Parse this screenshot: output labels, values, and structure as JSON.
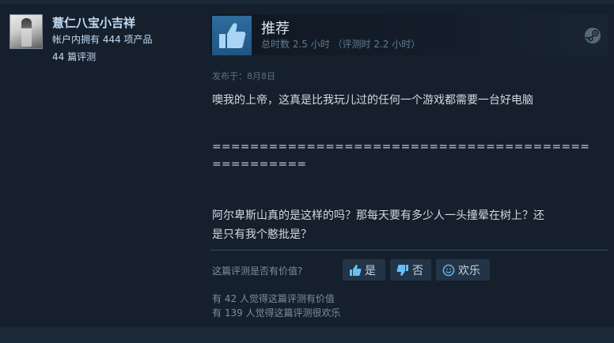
{
  "author": {
    "name": "薏仁八宝小吉祥",
    "products": "帐户内拥有 444 项产品",
    "reviews": "44 篇评测"
  },
  "review": {
    "verdict": "推荐",
    "hours": "总时数 2.5 小时 （评测时 2.2 小时）",
    "posted": "发布于：8月8日",
    "body": {
      "line1": "噢我的上帝，这真是比我玩儿过的任何一个游戏都需要一台好电脑",
      "line2": "========================================",
      "line3": "==========",
      "line4": "阿尔卑斯山真的是这样的吗？那每天要有多少人一头撞晕在树上？还",
      "line5": "是只有我个憨批是？"
    }
  },
  "vote": {
    "question": "这篇评测是否有价值?",
    "yes": "是",
    "no": "否",
    "funny": "欢乐"
  },
  "stats": {
    "helpful": "有 42 人觉得这篇评测有价值",
    "funny": "有 139 人觉得这篇评测很欢乐"
  },
  "icons": {
    "thumb": "thumbs-up-icon",
    "platform": "steam-icon",
    "yes": "thumbs-up-icon",
    "no": "thumbs-down-icon",
    "funny": "smiley-icon"
  },
  "colors": {
    "background": "#16202d",
    "accent": "#2e6d9c",
    "name": "#c1dbf4",
    "text": "#d0dae3",
    "muted": "#7d8d9c",
    "button": "#233447"
  }
}
